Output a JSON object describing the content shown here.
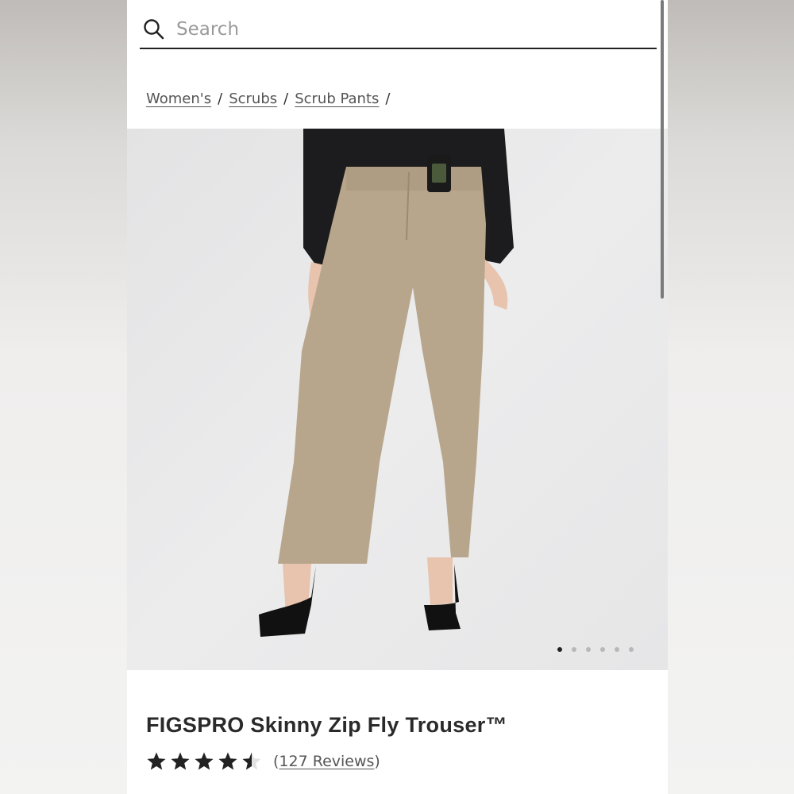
{
  "search": {
    "placeholder": "Search"
  },
  "breadcrumb": {
    "items": [
      {
        "label": "Women's"
      },
      {
        "label": "Scrubs"
      },
      {
        "label": "Scrub Pants"
      }
    ],
    "separator": "/"
  },
  "gallery": {
    "image_subject": "model wearing khaki skinny zip fly trousers with black top and black heels",
    "pants_color": "#b8a68c",
    "dots_total": 6,
    "active_dot": 1
  },
  "product": {
    "title": "FIGSPRO Skinny Zip Fly Trouser™",
    "rating": 4.5,
    "rating_max": 5,
    "reviews_open": "(",
    "reviews_label": "127 Reviews",
    "reviews_close": ")"
  }
}
